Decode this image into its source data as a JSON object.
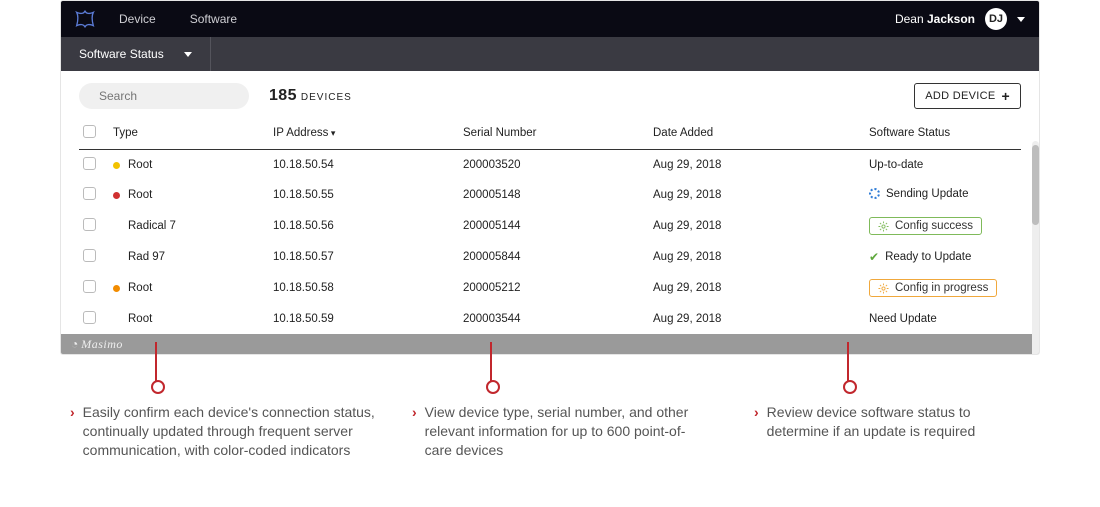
{
  "nav": {
    "items": [
      "Device",
      "Software"
    ],
    "user_first": "Dean",
    "user_last": "Jackson",
    "initials": "DJ"
  },
  "subbar": {
    "label": "Software Status"
  },
  "search": {
    "placeholder": "Search"
  },
  "count": {
    "value": "185",
    "label": "DEVICES"
  },
  "add_btn": "ADD DEVICE",
  "columns": {
    "type": "Type",
    "ip": "IP Address",
    "sn": "Serial Number",
    "date": "Date Added",
    "status": "Software Status"
  },
  "rows": [
    {
      "dot": "yellow",
      "type": "Root",
      "ip": "10.18.50.54",
      "sn": "200003520",
      "date": "Aug 29, 2018",
      "status_text": "Up-to-date",
      "status_kind": "plain"
    },
    {
      "dot": "red",
      "type": "Root",
      "ip": "10.18.50.55",
      "sn": "200005148",
      "date": "Aug 29, 2018",
      "status_text": "Sending Update",
      "status_kind": "spinner"
    },
    {
      "dot": "none",
      "type": "Radical 7",
      "ip": "10.18.50.56",
      "sn": "200005144",
      "date": "Aug 29, 2018",
      "status_text": "Config success",
      "status_kind": "box-green"
    },
    {
      "dot": "none",
      "type": "Rad 97",
      "ip": "10.18.50.57",
      "sn": "200005844",
      "date": "Aug 29, 2018",
      "status_text": "Ready to Update",
      "status_kind": "check"
    },
    {
      "dot": "orange",
      "type": "Root",
      "ip": "10.18.50.58",
      "sn": "200005212",
      "date": "Aug 29, 2018",
      "status_text": "Config in progress",
      "status_kind": "box-orange"
    },
    {
      "dot": "none",
      "type": "Root",
      "ip": "10.18.50.59",
      "sn": "200003544",
      "date": "Aug 29, 2018",
      "status_text": "Need Update",
      "status_kind": "plain"
    }
  ],
  "footer_brand": "Masimo",
  "annotations": {
    "a1": "Easily confirm each device's connection status, continually updated through frequent server communication, with color-coded indicators",
    "a2": "View device type, serial number, and other relevant information for up to 600 point-of-care devices",
    "a3": "Review device software status to determine if an update is required"
  }
}
